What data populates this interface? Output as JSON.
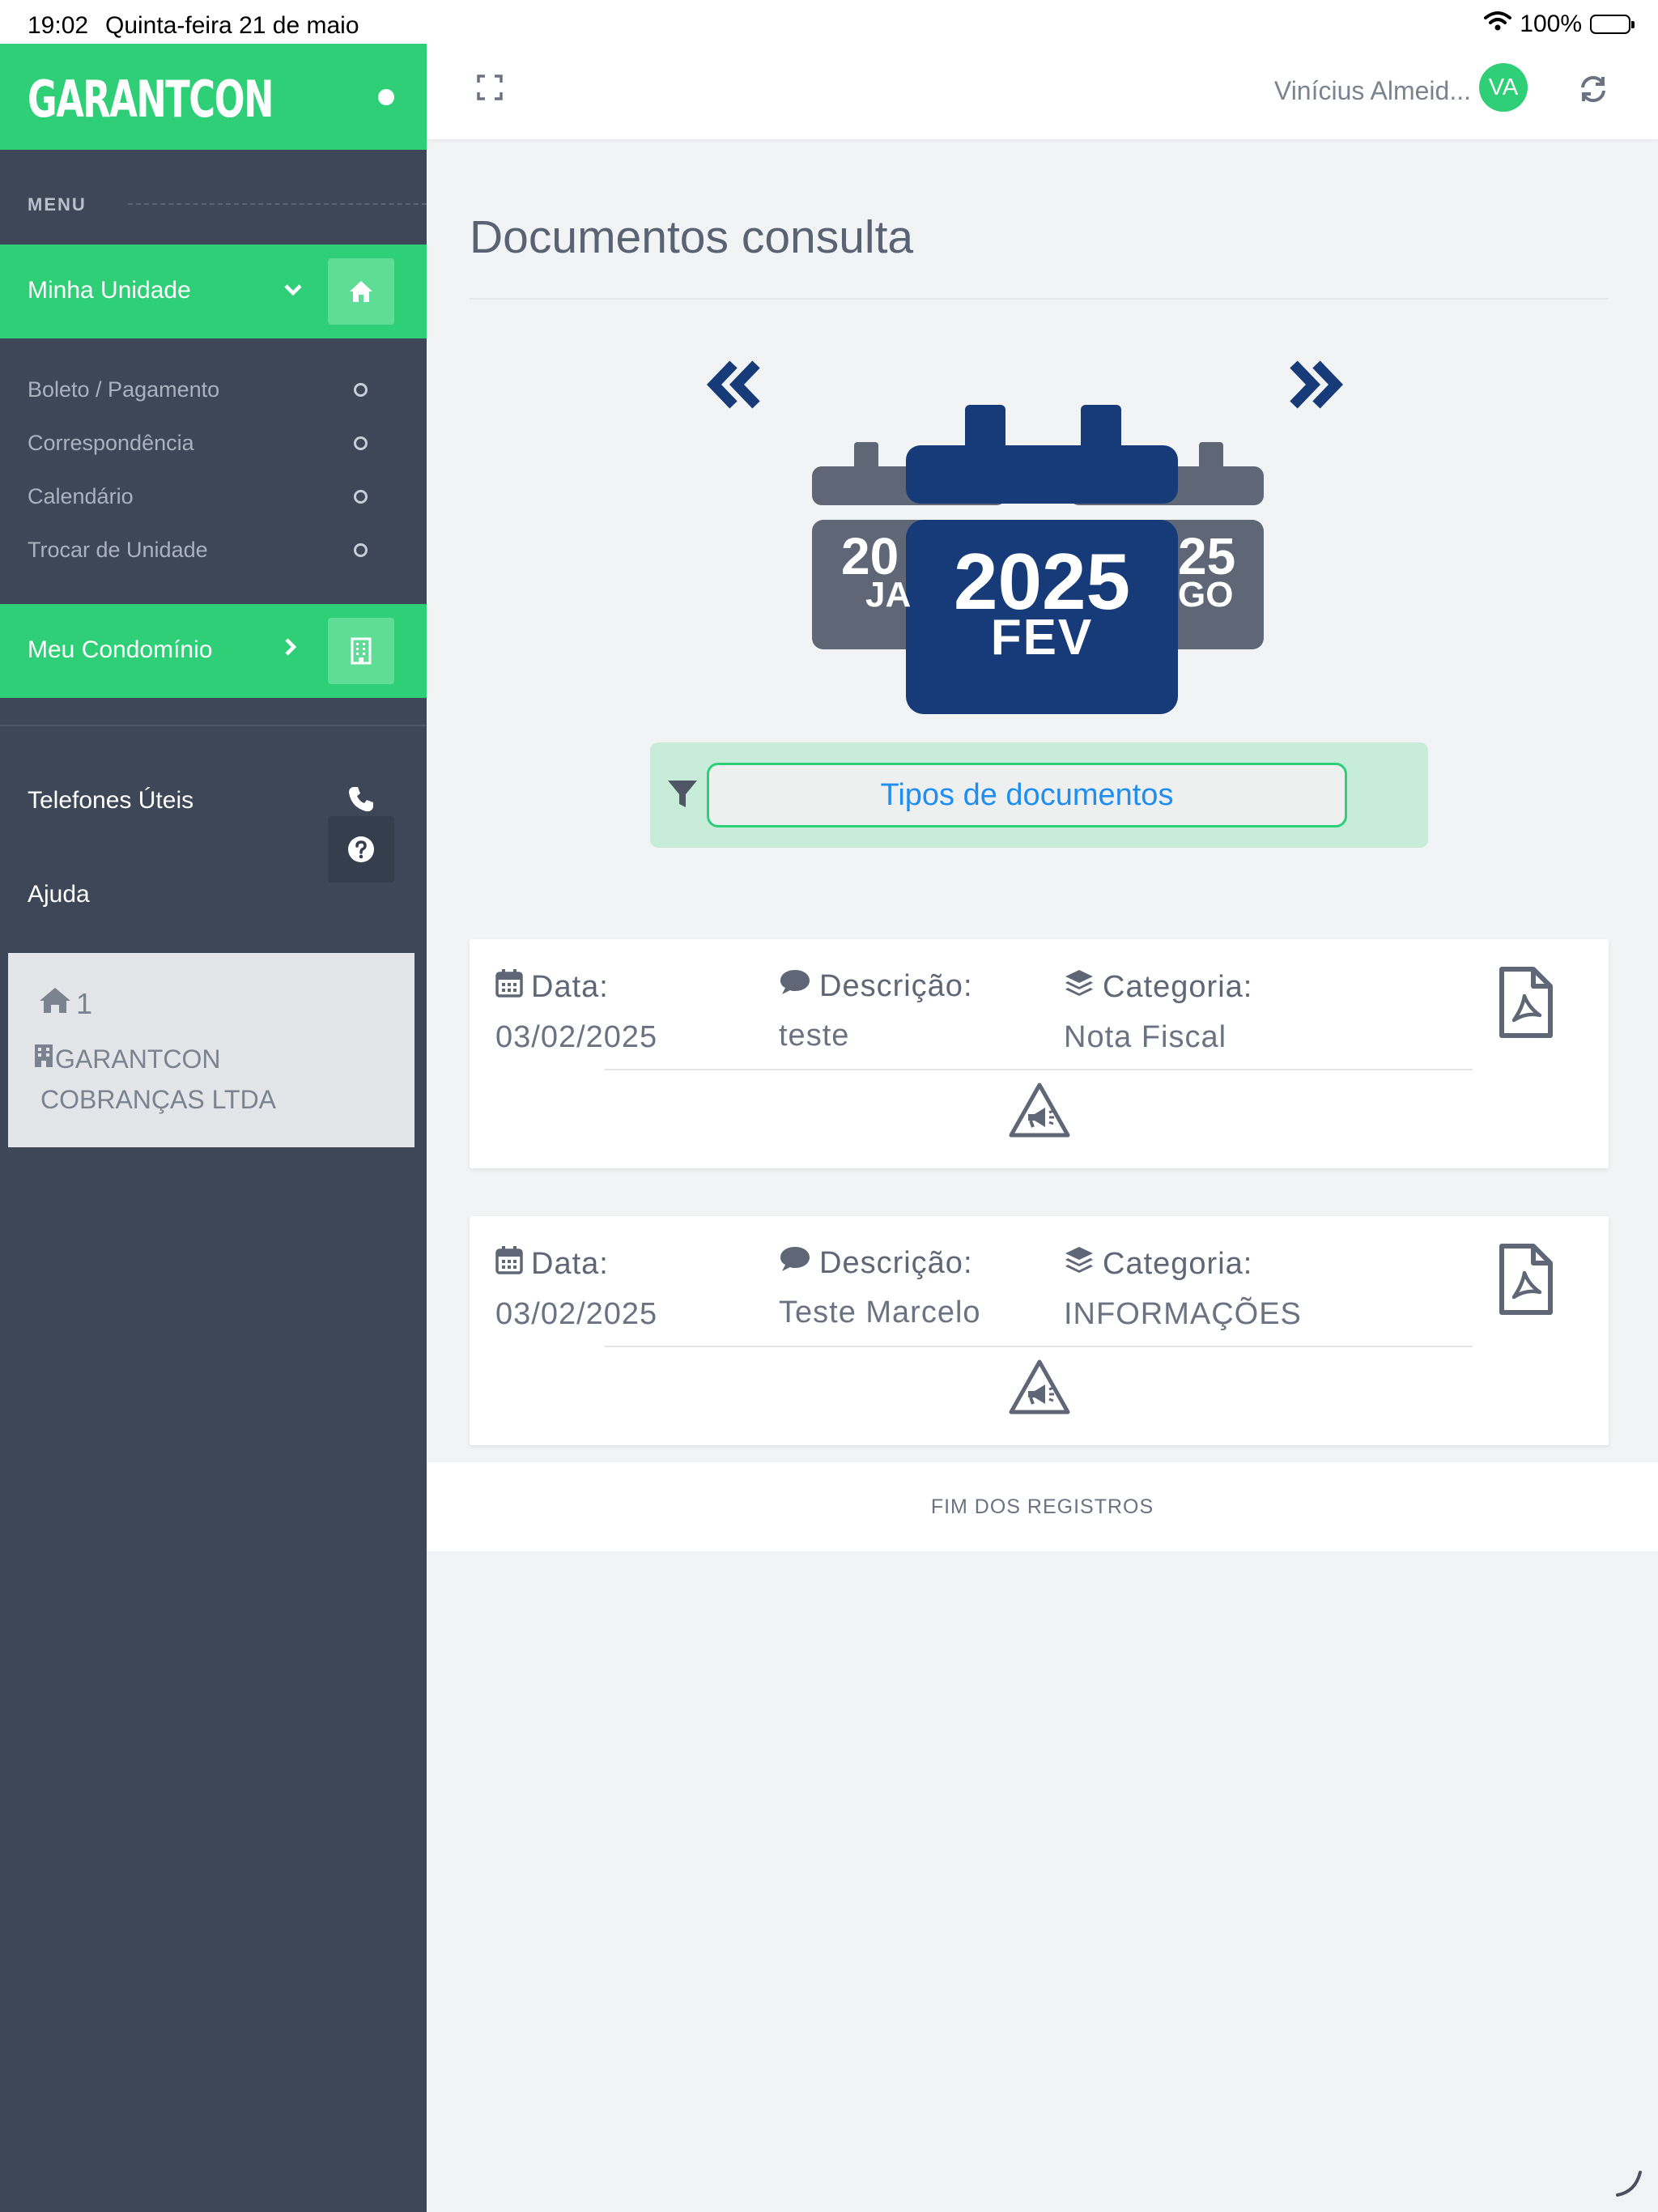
{
  "status_bar": {
    "time": "19:02",
    "date": "Quinta-feira 21 de maio",
    "battery": "100%"
  },
  "sidebar": {
    "logo": "GARANTCON",
    "menu_label": "MENU",
    "sections": [
      {
        "label": "Minha Unidade",
        "icon": "home-icon"
      },
      {
        "label": "Meu Condomínio",
        "icon": "building-icon"
      }
    ],
    "sub_items": [
      {
        "label": "Boleto / Pagamento"
      },
      {
        "label": "Correspondência"
      },
      {
        "label": "Calendário"
      },
      {
        "label": "Trocar de Unidade"
      }
    ],
    "plain_items": [
      {
        "label": "Telefones Úteis",
        "icon": "phone-icon"
      },
      {
        "label": "Ajuda",
        "icon": "question-icon"
      }
    ],
    "unit": {
      "number": "1",
      "name_line1": "GARANTCON",
      "name_line2": "COBRANÇAS LTDA"
    }
  },
  "header": {
    "user_name": "Vinícius Almeid...",
    "avatar_initials": "VA"
  },
  "main": {
    "title": "Documentos consulta",
    "calendar": {
      "current_year": "2025",
      "current_month": "FEV",
      "prev_year_partial": "20",
      "prev_month_partial": "JA",
      "next_year_partial": "25",
      "next_month_partial": "GO"
    },
    "filter_button": "Tipos de documentos",
    "labels": {
      "date": "Data:",
      "description": "Descrição:",
      "category": "Categoria:"
    },
    "documents": [
      {
        "date": "03/02/2025",
        "description": "teste",
        "category": "Nota Fiscal"
      },
      {
        "date": "03/02/2025",
        "description": "Teste Marcelo",
        "category": "INFORMAÇÕES"
      }
    ],
    "end_text": "FIM DOS REGISTROS"
  },
  "colors": {
    "brand_green": "#2fcf77",
    "sidebar_bg": "#3d4757",
    "calendar_navy": "#173a78",
    "calendar_gray": "#5f6676",
    "link_blue": "#1f8ef1"
  }
}
